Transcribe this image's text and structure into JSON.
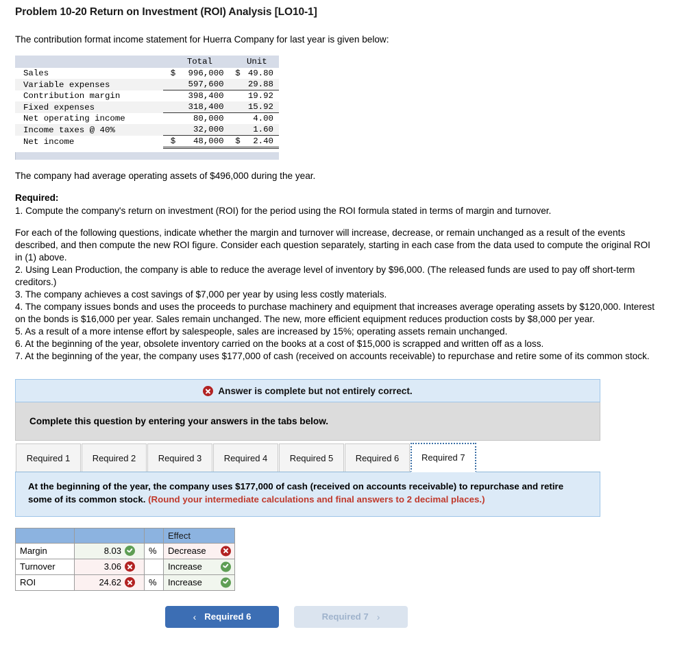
{
  "problem": {
    "title": "Problem 10-20 Return on Investment (ROI) Analysis [LO10-1]",
    "intro": "The contribution format income statement for Huerra Company for last year is given below:"
  },
  "income_statement": {
    "columns": [
      "",
      "Total",
      "Unit"
    ],
    "rows": [
      {
        "label": "Sales",
        "total_currency": "$",
        "total": "996,000",
        "unit_currency": "$",
        "unit": "49.80"
      },
      {
        "label": "Variable expenses",
        "total_currency": "",
        "total": "597,600",
        "unit_currency": "",
        "unit": "29.88"
      },
      {
        "label": "Contribution margin",
        "total_currency": "",
        "total": "398,400",
        "unit_currency": "",
        "unit": "19.92"
      },
      {
        "label": "Fixed expenses",
        "total_currency": "",
        "total": "318,400",
        "unit_currency": "",
        "unit": "15.92"
      },
      {
        "label": "Net operating income",
        "total_currency": "",
        "total": "80,000",
        "unit_currency": "",
        "unit": "4.00"
      },
      {
        "label": "Income taxes @ 40%",
        "total_currency": "",
        "total": "32,000",
        "unit_currency": "",
        "unit": "1.60"
      },
      {
        "label": "Net income",
        "total_currency": "$",
        "total": "48,000",
        "unit_currency": "$",
        "unit": "2.40"
      }
    ]
  },
  "assets_note": "The company had average operating assets of $496,000 during the year.",
  "required": {
    "heading": "Required:",
    "item1": "1. Compute the company's return on investment (ROI) for the period using the ROI formula stated in terms of margin and turnover.",
    "lead_in": "For each of the following questions, indicate whether the margin and turnover will increase, decrease, or remain unchanged as a result of the events described, and then compute the new ROI figure. Consider each question separately, starting in each case from the data used to compute the original ROI in (1) above.",
    "item2": "2. Using Lean Production, the company is able to reduce the average level of inventory by $96,000. (The released funds are used to pay off short-term creditors.)",
    "item3": "3. The company achieves a cost savings of $7,000 per year by using less costly materials.",
    "item4": "4. The company issues bonds and uses the proceeds to purchase machinery and equipment that increases average operating assets by $120,000. Interest on the bonds is $16,000 per year. Sales remain unchanged. The new, more efficient equipment reduces production costs by $8,000 per year.",
    "item5": "5. As a result of a more intense effort by salespeople, sales are increased by 15%; operating assets remain unchanged.",
    "item6": "6. At the beginning of the year, obsolete inventory carried on the books at a cost of $15,000 is scrapped and written off as a loss.",
    "item7": "7. At the beginning of the year, the company uses $177,000 of cash (received on accounts receivable) to repurchase and retire some of its common stock."
  },
  "status_banner": {
    "icon": "x-circle-icon",
    "text": "Answer is complete but not entirely correct."
  },
  "instruction_bar": {
    "text": "Complete this question by entering your answers in the tabs below."
  },
  "tabs": [
    {
      "label": "Required 1",
      "active": false
    },
    {
      "label": "Required 2",
      "active": false
    },
    {
      "label": "Required 3",
      "active": false
    },
    {
      "label": "Required 4",
      "active": false
    },
    {
      "label": "Required 5",
      "active": false
    },
    {
      "label": "Required 6",
      "active": false
    },
    {
      "label": "Required 7",
      "active": true
    }
  ],
  "req_prompt": {
    "text": "At the beginning of the year, the company uses $177,000 of cash (received on accounts receivable) to repurchase and retire some of its common stock. ",
    "note": "(Round your intermediate calculations and final answers to 2 decimal places.)"
  },
  "answer_table": {
    "headers": [
      "",
      "",
      "",
      "Effect"
    ],
    "rows": [
      {
        "label": "Margin",
        "value": "8.03",
        "value_status": "correct",
        "unit": "%",
        "effect": "Decrease",
        "effect_status": "incorrect"
      },
      {
        "label": "Turnover",
        "value": "3.06",
        "value_status": "incorrect",
        "unit": "",
        "effect": "Increase",
        "effect_status": "correct"
      },
      {
        "label": "ROI",
        "value": "24.62",
        "value_status": "incorrect",
        "unit": "%",
        "effect": "Increase",
        "effect_status": "correct"
      }
    ]
  },
  "navigation": {
    "prev_label": "Required 6",
    "prev_chevron": "‹",
    "next_label": "Required 7",
    "next_chevron": "›"
  },
  "colors": {
    "accent_blue": "#3c6eb4",
    "banner_blue": "#dceaf7",
    "table_header_blue": "#8cb3e0",
    "correct_green": "#5e9e54",
    "incorrect_red": "#b22222",
    "note_red": "#c0392b"
  }
}
